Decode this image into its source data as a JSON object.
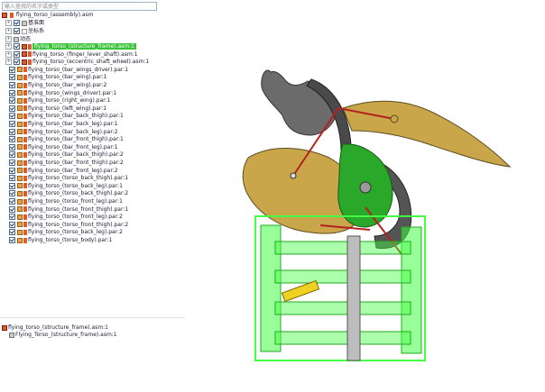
{
  "search": {
    "placeholder": "输入查找的名字或类型"
  },
  "tree": {
    "root": "flying_torso_(assembly).asm",
    "nodes_top": [
      "基准面",
      "坐标系",
      "动态"
    ],
    "items": [
      "flying_torso_(structure_frame).asm:1",
      "flying_torso_(finger_lever_shaft).asm:1",
      "flying_torso_(eccentric_shaft_wheel).asm:1",
      "flying_torso_(bar_wings_driver).par:1",
      "flying_torso_(bar_wing).par:1",
      "flying_torso_(bar_wing).par:2",
      "flying_torso_(wings_driver).par:1",
      "flying_torso_(right_wing).par:1",
      "flying_torso_(left_wing).par:1",
      "flying_torso_(bar_back_thigh).par:1",
      "flying_torso_(bar_back_leg).par:1",
      "flying_torso_(bar_back_leg).par:2",
      "flying_torso_(bar_front_thigh).par:1",
      "flying_torso_(bar_front_leg).par:1",
      "flying_torso_(bar_back_thigh).par:2",
      "flying_torso_(bar_front_thigh).par:2",
      "flying_torso_(bar_front_leg).par:2",
      "flying_torso_(torso_back_thigh).par:1",
      "flying_torso_(torso_back_leg).par:1",
      "flying_torso_(torso_back_thigh).par:2",
      "flying_torso_(torso_front_leg).par:1",
      "flying_torso_(torso_front_thigh).par:1",
      "flying_torso_(torso_front_leg).par:2",
      "flying_torso_(torso_front_thigh).par:2",
      "flying_torso_(torso_back_leg).par:2",
      "flying_torso_(torso_body).par:1"
    ],
    "selected_index": 0
  },
  "bottom": {
    "title": "flying_torso_(structure_frame).asm:1",
    "sub": "Flying_Torso_(structure_frame).asm:1"
  },
  "colors": {
    "selection": "#3ac43a",
    "frame": "#44ff44",
    "wing": "#c9a64a",
    "gear": "#555555",
    "green_part": "#2aa82a",
    "link": "#b52020"
  }
}
